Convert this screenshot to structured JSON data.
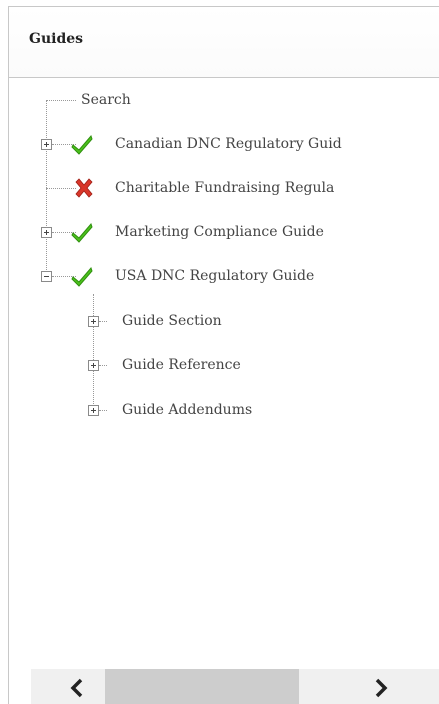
{
  "panel": {
    "title": "Guides"
  },
  "tree": {
    "search_label": "Search",
    "items": [
      {
        "label": "Canadian DNC Regulatory Guid",
        "status": "check",
        "expanded": false
      },
      {
        "label": "Charitable Fundraising Regula",
        "status": "cross",
        "expanded": false
      },
      {
        "label": "Marketing Compliance Guide",
        "status": "check",
        "expanded": false
      },
      {
        "label": "USA DNC Regulatory Guide",
        "status": "check",
        "expanded": true
      }
    ],
    "children": [
      {
        "label": "Guide Section"
      },
      {
        "label": "Guide Reference"
      },
      {
        "label": "Guide Addendums"
      }
    ]
  },
  "scrollbar": {
    "left_icon": "chevron-left-icon",
    "right_icon": "chevron-right-icon"
  },
  "colors": {
    "check": "#4cc21c",
    "cross": "#d9362a",
    "border": "#c8c8c8"
  }
}
